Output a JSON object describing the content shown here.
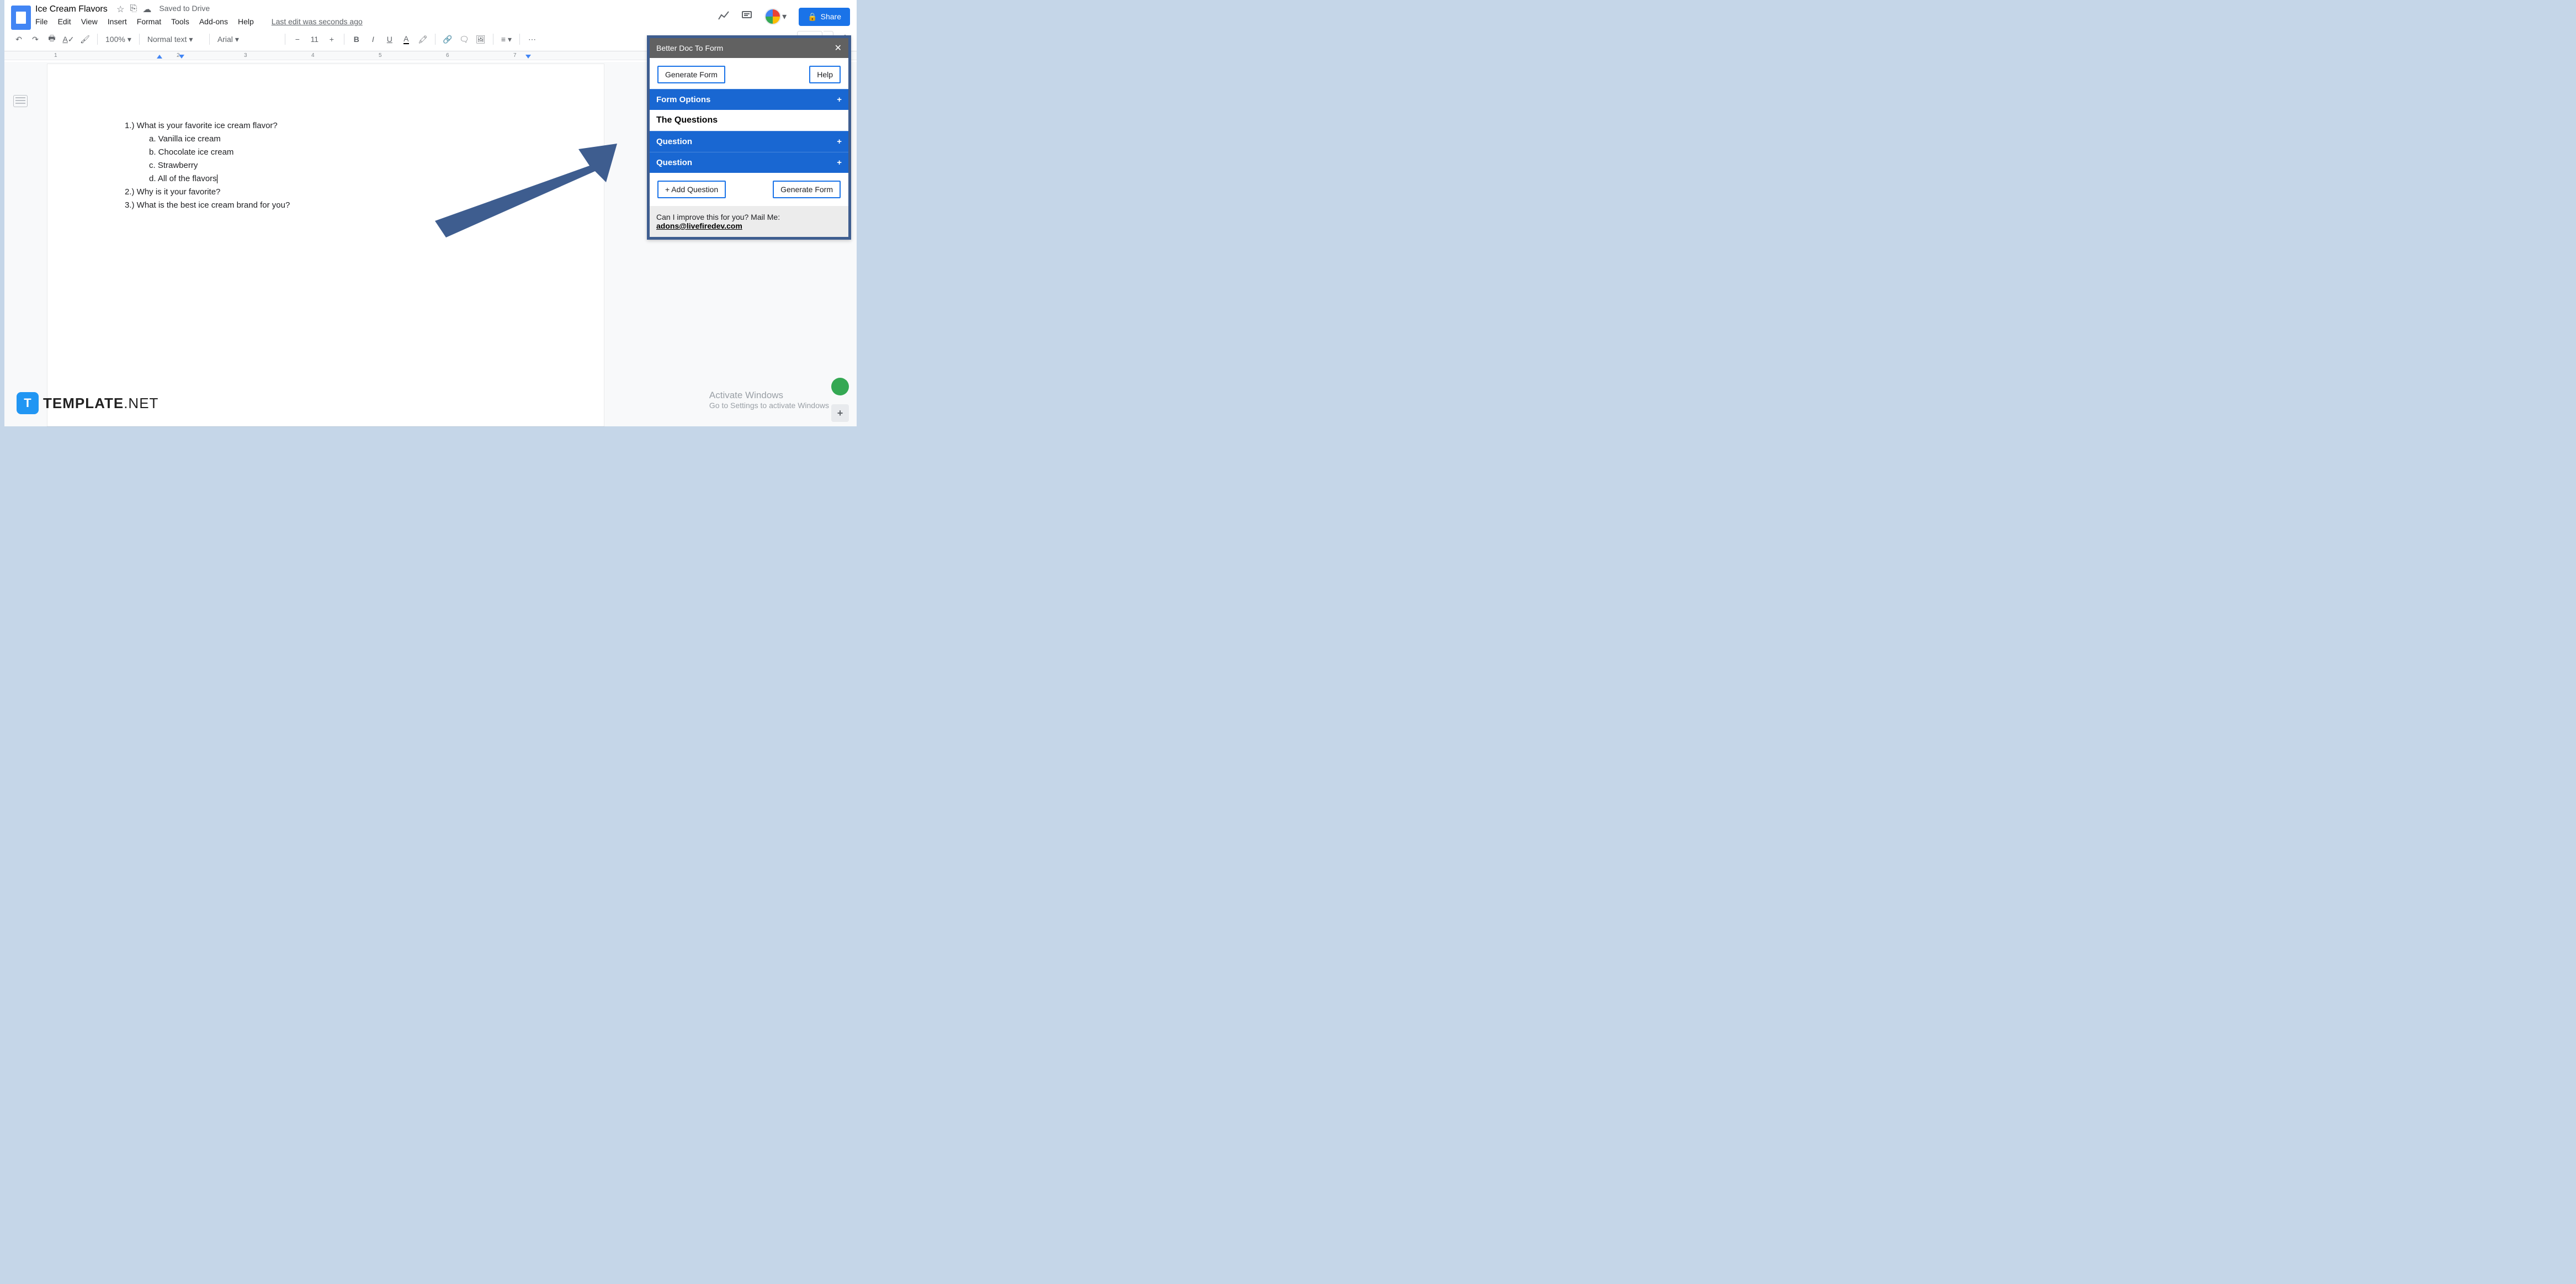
{
  "header": {
    "doc_title": "Ice Cream Flavors",
    "saved_text": "Saved to Drive",
    "last_edit": "Last edit was seconds ago",
    "menu": {
      "file": "File",
      "edit": "Edit",
      "view": "View",
      "insert": "Insert",
      "format": "Format",
      "tools": "Tools",
      "addons": "Add-ons",
      "help": "Help"
    },
    "share_label": "Share"
  },
  "toolbar": {
    "zoom": "100%",
    "style": "Normal text",
    "font": "Arial",
    "size": "11"
  },
  "ruler": {
    "m1": "1",
    "m2": "2",
    "m3": "3",
    "m4": "4",
    "m5": "5",
    "m6": "6",
    "m7": "7"
  },
  "document": {
    "q1": "1.)  What is your favorite ice cream flavor?",
    "q1a": "a.   Vanilla ice cream",
    "q1b": "b.   Chocolate ice cream",
    "q1c": "c.   Strawberry",
    "q1d": "d.   All of the flavors",
    "q2": "2.)  Why is it your favorite?",
    "q3": "3.)  What is the best ice cream brand for you?"
  },
  "panel": {
    "title": "Better Doc To Form",
    "close": "✕",
    "generate_btn": "Generate Form",
    "help_btn": "Help",
    "form_options": "Form Options",
    "the_questions": "The Questions",
    "question": "Question",
    "add_question": "+ Add Question",
    "generate_form2": "Generate Form",
    "mail_prompt": "Can I improve this for you? Mail Me:",
    "mail": "adons@livefiredev.com",
    "plus": "+"
  },
  "activate": {
    "t1": "Activate Windows",
    "t2": "Go to Settings to activate Windows"
  },
  "brand": {
    "t": "T",
    "name": "TEMPLATE",
    "net": ".NET"
  }
}
